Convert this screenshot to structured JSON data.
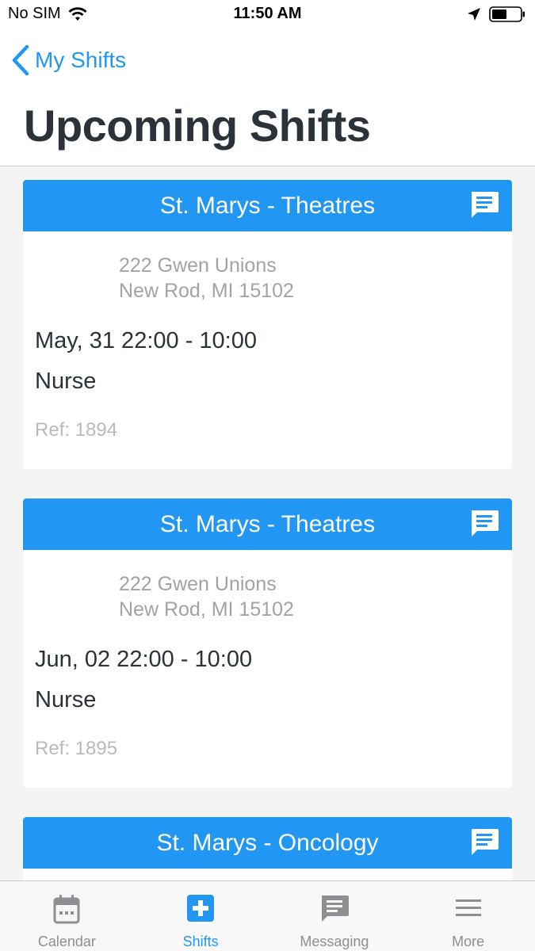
{
  "status_bar": {
    "carrier": "No SIM",
    "time": "11:50 AM"
  },
  "header": {
    "back_label": "My Shifts",
    "title": "Upcoming Shifts"
  },
  "shifts": [
    {
      "location": "St. Marys - Theatres",
      "address_line1": "222 Gwen Unions",
      "address_line2": "New Rod, MI 15102",
      "datetime": "May, 31 22:00 - 10:00",
      "role": "Nurse",
      "ref": "Ref: 1894"
    },
    {
      "location": "St. Marys - Theatres",
      "address_line1": "222 Gwen Unions",
      "address_line2": "New Rod, MI 15102",
      "datetime": "Jun, 02 22:00 - 10:00",
      "role": "Nurse",
      "ref": "Ref: 1895"
    },
    {
      "location": "St. Marys - Oncology"
    }
  ],
  "tab_bar": {
    "tabs": [
      {
        "label": "Calendar",
        "icon": "calendar-icon"
      },
      {
        "label": "Shifts",
        "icon": "medical-cross-icon",
        "active": true
      },
      {
        "label": "Messaging",
        "icon": "message-icon"
      },
      {
        "label": "More",
        "icon": "menu-icon"
      }
    ]
  },
  "colors": {
    "accent": "#2196f3",
    "title_text": "#2b323a",
    "secondary_text": "#a3a3a3",
    "background": "#f4f4f4"
  }
}
